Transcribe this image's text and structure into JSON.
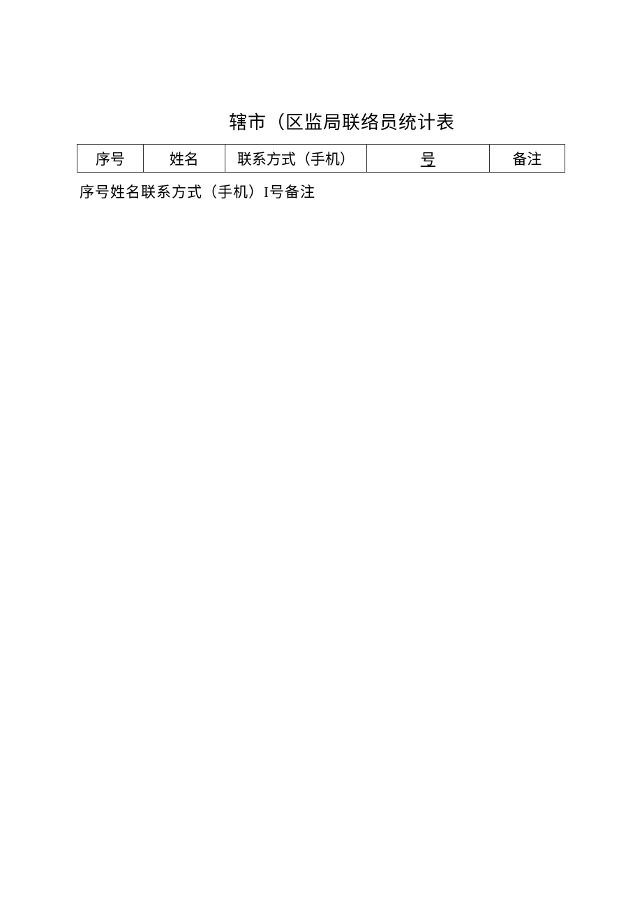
{
  "title": "辖市（区监局联络员统计表",
  "table": {
    "headers": {
      "seq": "序号",
      "name": "姓名",
      "contact": "联系方式（手机）",
      "hao": "号",
      "remark": "备注"
    }
  },
  "footer_text": "序号姓名联系方式（手机）I号备注"
}
